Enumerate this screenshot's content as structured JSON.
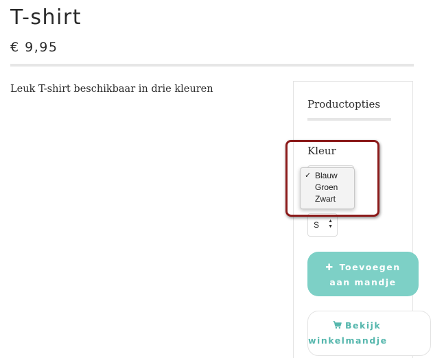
{
  "product": {
    "title": "T-shirt",
    "price": "€ 9,95",
    "description": "Leuk T-shirt beschikbaar in drie kleuren"
  },
  "options": {
    "title": "Productopties",
    "color_label": "Kleur",
    "color_options": [
      {
        "label": "Blauw",
        "selected": true
      },
      {
        "label": "Groen",
        "selected": false
      },
      {
        "label": "Zwart",
        "selected": false
      }
    ],
    "check_mark": "✓",
    "size_value": "S"
  },
  "actions": {
    "add_to_cart_line1": "Toevoegen",
    "add_to_cart_line2": "aan mandje",
    "view_cart_line1": "Bekijk",
    "view_cart_line2": "winkelmandje"
  },
  "colors": {
    "accent": "#7dd0c6",
    "accent_text": "#56b7ad",
    "highlight": "#8b1a1a"
  },
  "icons": {
    "add": "plus-icon",
    "cart": "cart-icon",
    "select": "updown-arrows-icon"
  }
}
